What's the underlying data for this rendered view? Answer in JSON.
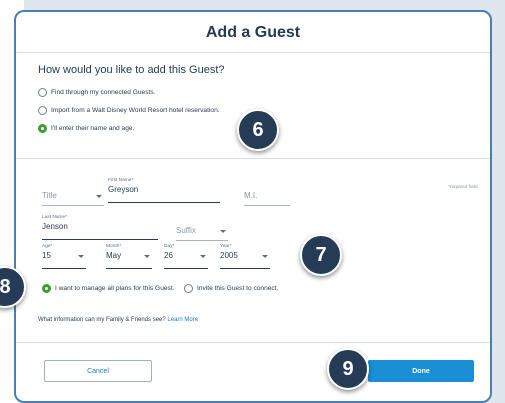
{
  "modal": {
    "title": "Add a Guest",
    "question": "How would you like to add this Guest?",
    "options": [
      {
        "label": "Find through my connected Guests.",
        "selected": false
      },
      {
        "label": "Import from a Walt Disney World Resort hotel reservation.",
        "selected": false
      },
      {
        "label": "I'll enter their name and age.",
        "selected": true
      }
    ],
    "required_note": "*required field",
    "fields": {
      "title": {
        "placeholder": "Title"
      },
      "first_name": {
        "label": "First Name*",
        "value": "Greyson"
      },
      "mi": {
        "placeholder": "M.I."
      },
      "last_name": {
        "label": "Last Name*",
        "value": "Jenson"
      },
      "suffix": {
        "placeholder": "Suffix"
      },
      "age": {
        "label": "Age*",
        "value": "15"
      },
      "month": {
        "label": "Month*",
        "value": "May"
      },
      "day": {
        "label": "Day*",
        "value": "26"
      },
      "year": {
        "label": "Year*",
        "value": "2005"
      }
    },
    "manage_options": [
      {
        "label": "I want to manage all plans for this Guest.",
        "selected": true
      },
      {
        "label": "Invite this Guest to connect.",
        "selected": false
      }
    ],
    "info_text": "What information can my Family & Friends see?",
    "info_link": "Learn More",
    "cancel_label": "Cancel",
    "done_label": "Done"
  },
  "badges": [
    "6",
    "7",
    "8",
    "9"
  ],
  "colors": {
    "accent": "#1a8fd6",
    "selected_radio": "#3f9c35",
    "badge": "#253b56",
    "text": "#253b56",
    "border": "#4a7fb0"
  }
}
